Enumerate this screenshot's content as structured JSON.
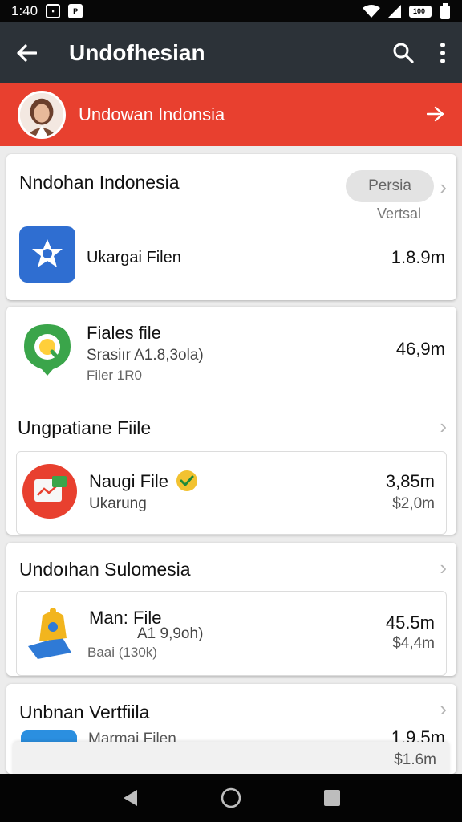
{
  "status_bar": {
    "time": "1:40",
    "icon1": "notification-icon",
    "icon2": "app-notification-icon",
    "battery": "100"
  },
  "app_bar": {
    "title": "Undofhesian",
    "back_icon": "back-arrow-icon",
    "search_icon": "search-icon",
    "menu_icon": "more-vert-icon"
  },
  "banner": {
    "label": "Undowan Indonsia",
    "avatar_icon": "avatar",
    "arrow_icon": "arrow-right-icon",
    "color": "#e8402f"
  },
  "card1": {
    "title": "Nndohan Indonesia",
    "pill_label": "Persia",
    "pill_caption": "Vertsal",
    "item": {
      "name": "Ukargai Filen",
      "size": "1.8.9m",
      "icon": "star-app-icon"
    }
  },
  "card2": {
    "item": {
      "name": "Fiales file",
      "sub": "Srasiır A1.8,3ola)",
      "sub2": "Filer 1R0",
      "size": "46,9m",
      "icon": "chat-app-icon"
    },
    "section_title": "Ungpatiane Fiile",
    "inner_item": {
      "name": "Naugi File",
      "sub": "Ukarung",
      "size": "3,85m",
      "size2": "$2,0m",
      "icon": "document-app-icon",
      "badge_icon": "check-badge-icon"
    }
  },
  "card3": {
    "title": "Undoıhan Sulomesia",
    "inner_item": {
      "name": "Man: File",
      "sub": "A1 9,9oh)",
      "sub2": "Baai (130k)",
      "size": "45.5m",
      "size2": "$4,4m",
      "icon": "bell-app-icon"
    }
  },
  "card4": {
    "title": "Unbnan Vertfiila",
    "inner_item": {
      "name": "Marmai Filen",
      "size": "1.9.5m",
      "size2": "$1.6m",
      "icon": "blue-app-icon"
    }
  },
  "nav_bar": {
    "back": "back-triangle-icon",
    "home": "home-circle-icon",
    "recents": "recents-square-icon"
  }
}
